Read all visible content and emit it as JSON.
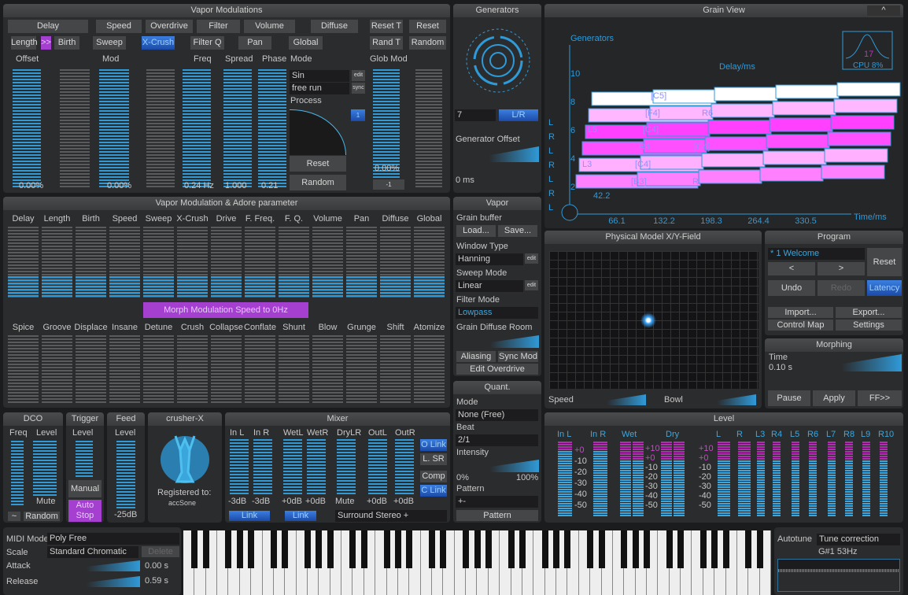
{
  "vapor_mod": {
    "title": "Vapor Modulations",
    "row1": [
      "Delay",
      "Speed",
      "Overdrive",
      "Filter",
      "Volume",
      "Diffuse",
      "Reset T",
      "Reset"
    ],
    "row2": [
      "Length",
      ">>",
      "Birth",
      "Sweep",
      "X-Crush",
      "Filter Q",
      "Pan",
      "Global",
      "Rand T",
      "Random"
    ],
    "labels": {
      "offset": "Offset",
      "mod": "Mod",
      "freq": "Freq",
      "spread": "Spread",
      "phase": "Phase",
      "mode": "Mode",
      "glob_mod": "Glob Mod",
      "process": "Process"
    },
    "values": {
      "offset": "0.00%",
      "mod": "0.00%",
      "freq": "0.24 Hz",
      "spread": "1.000",
      "phase": "0.21",
      "glob_mod": "0.00%",
      "glob_step": "-1"
    },
    "mode_value": "Sin",
    "mode_edit": "edit",
    "run_value": "free run",
    "run_sync": "sync",
    "process_num": "1",
    "reset": "Reset",
    "random": "Random"
  },
  "generators": {
    "title": "Generators",
    "count": "7",
    "lr": "L/R",
    "offset_label": "Generator Offset",
    "offset_value": "0 ms"
  },
  "grain": {
    "title": "Grain View",
    "collapse": "^",
    "y_label": "Generators",
    "x_label": "Time/ms",
    "delay_label": "Delay/ms",
    "delay_value": "42.2",
    "y_ticks": [
      "10",
      "8",
      "6",
      "4",
      "2"
    ],
    "x_ticks": [
      "66.1",
      "132.2",
      "198.3",
      "264.4",
      "330.5"
    ],
    "lr": [
      "L",
      "R",
      "L",
      "R",
      "L",
      "R",
      "L"
    ],
    "grain_labels": [
      "[C5]",
      "[F4]",
      "R6",
      "L5",
      "[C4]",
      "[C4]",
      "R4",
      "L3",
      "[C4]",
      "[B3]",
      "R"
    ],
    "cpu_num": "17",
    "cpu": "CPU 8%"
  },
  "adore": {
    "title": "Vapor Modulation & Adore parameter",
    "top": [
      "Delay",
      "Length",
      "Birth",
      "Speed",
      "Sweep",
      "X-Crush",
      "Drive",
      "F. Freq.",
      "F. Q.",
      "Volume",
      "Pan",
      "Diffuse",
      "Global"
    ],
    "bottom": [
      "Spice",
      "Groove",
      "Displace",
      "Insane",
      "Detune",
      "Crush",
      "Collapse",
      "Conflate",
      "Shunt",
      "Blow",
      "Grunge",
      "Shift",
      "Atomize"
    ],
    "morph": "Morph Modulation Speed to 0Hz"
  },
  "vapor": {
    "title": "Vapor",
    "grain_buffer": "Grain buffer",
    "load": "Load...",
    "save": "Save...",
    "window_type": "Window Type",
    "window": "Hanning",
    "sweep_mode": "Sweep Mode",
    "sweep": "Linear",
    "filter_mode": "Filter Mode",
    "filter": "Lowpass",
    "diffuse_room": "Grain Diffuse Room",
    "aliasing": "Aliasing",
    "sync_mod": "Sync Mod",
    "edit_overdrive": "Edit Overdrive",
    "edit": "edit"
  },
  "quant": {
    "title": "Quant.",
    "mode_label": "Mode",
    "mode": "None (Free)",
    "beat_label": "Beat",
    "beat": "2/1",
    "intensity_label": "Intensity",
    "min": "0%",
    "max": "100%",
    "pattern_label": "Pattern",
    "pattern": "+-",
    "pattern_btn": "Pattern"
  },
  "xy": {
    "title": "Physical Model X/Y-Field",
    "speed": "Speed",
    "bowl": "Bowl"
  },
  "program": {
    "title": "Program",
    "name": "* 1 Welcome",
    "reset": "Reset",
    "prev": "<",
    "next": ">",
    "undo": "Undo",
    "redo": "Redo",
    "latency": "Latency",
    "import": "Import...",
    "export": "Export...",
    "control_map": "Control Map",
    "settings": "Settings"
  },
  "morphing": {
    "title": "Morphing",
    "time_label": "Time",
    "time": "0.10 s",
    "pause": "Pause",
    "apply": "Apply",
    "ff": "FF>>"
  },
  "dco": {
    "title": "DCO",
    "freq": "Freq",
    "level": "Level",
    "mute": "Mute",
    "wave": "~",
    "random": "Random"
  },
  "trigger": {
    "title": "Trigger",
    "level": "Level",
    "manual": "Manual",
    "auto_stop": "Auto Stop"
  },
  "feed": {
    "title": "Feed",
    "level": "Level",
    "value": "-25dB"
  },
  "crusher": {
    "title": "crusher-X",
    "registered": "Registered to:",
    "user": "accSone"
  },
  "mixer": {
    "title": "Mixer",
    "channels": [
      "In L",
      "In R",
      "WetL",
      "WetR",
      "DryLR",
      "OutL",
      "OutR"
    ],
    "values": [
      "-3dB",
      "-3dB",
      "+0dB",
      "+0dB",
      "Mute",
      "+0dB",
      "+0dB"
    ],
    "link": "Link",
    "o_link": "O Link",
    "l_sr": "L. SR",
    "comp": "Comp",
    "c_link": "C Link",
    "surround": "Surround Stereo +"
  },
  "level": {
    "title": "Level",
    "channels": [
      "In L",
      "In R",
      "Wet",
      "Dry",
      "L",
      "R",
      "L3",
      "R4",
      "L5",
      "R6",
      "L7",
      "R8",
      "L9",
      "R10"
    ],
    "scale_a": [
      "+0",
      "-10",
      "-20",
      "-30",
      "-40",
      "-50"
    ],
    "scale_b": [
      "+10",
      "+0",
      "-10",
      "-20",
      "-30",
      "-40",
      "-50"
    ]
  },
  "midi": {
    "mode_label": "MIDI Mode",
    "mode": "Poly Free",
    "scale_label": "Scale",
    "scale": "Standard Chromatic",
    "delete": "Delete",
    "attack_label": "Attack",
    "attack": "0.00 s",
    "release_label": "Release",
    "release": "0.59 s"
  },
  "autotune": {
    "label": "Autotune",
    "mode": "Tune correction",
    "note": "G#1 53Hz"
  },
  "colors": {
    "accent": "#2f9ad8",
    "purple": "#a43fd0",
    "magenta": "#ff40ff",
    "panel": "#2b2c2e"
  }
}
